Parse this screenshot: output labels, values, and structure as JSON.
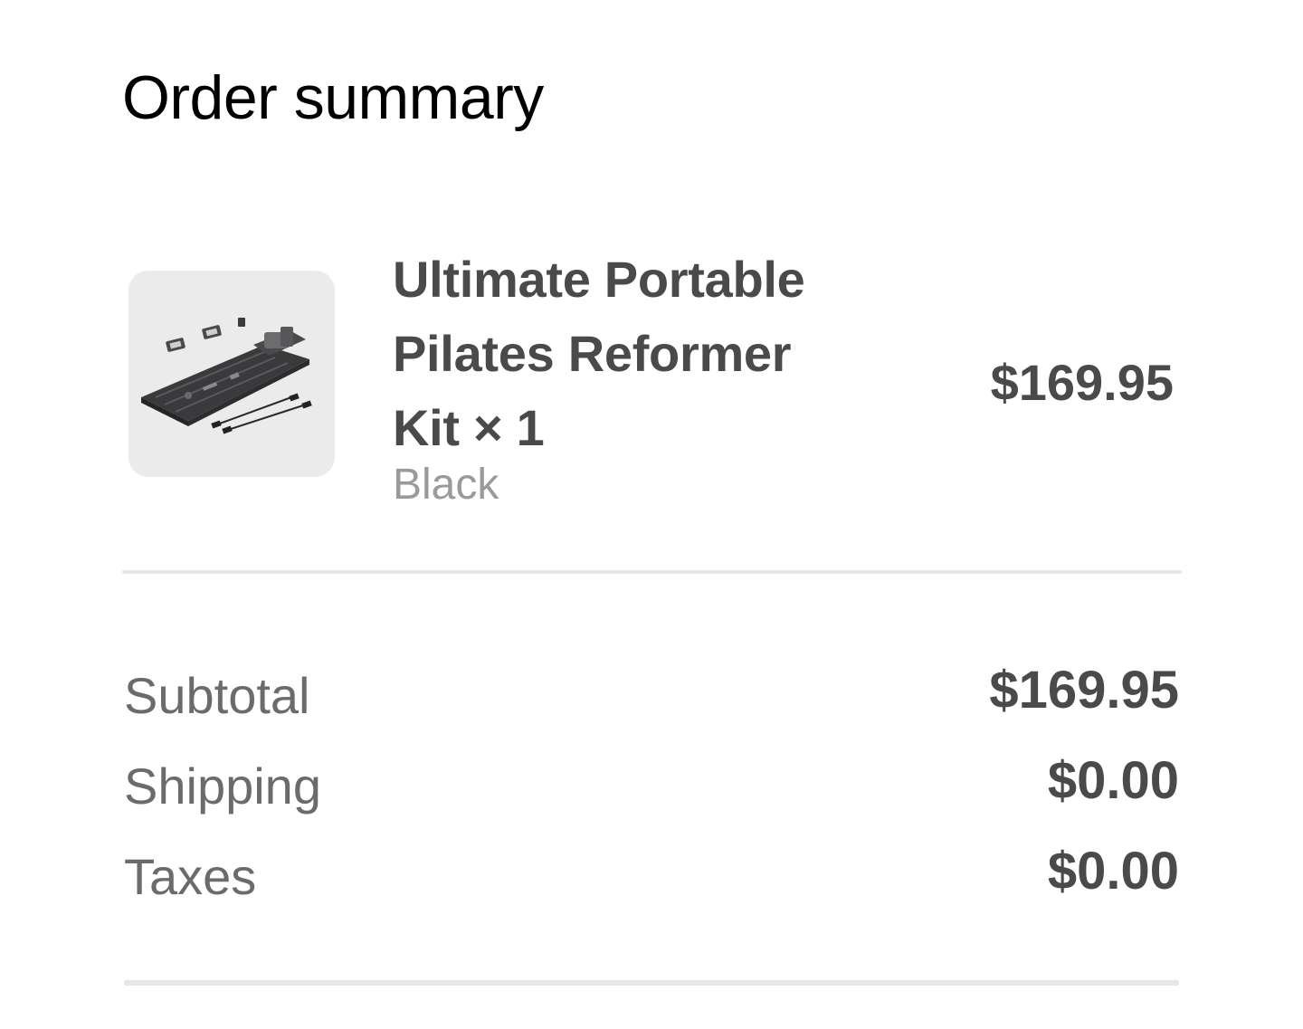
{
  "page": {
    "title": "Order summary"
  },
  "item": {
    "name": "Ultimate Portable Pilates Reformer Kit × 1",
    "variant": "Black",
    "price": "$169.95",
    "image_icon": "pilates-reformer-kit-image"
  },
  "totals": {
    "subtotal_label": "Subtotal",
    "subtotal_value": "$169.95",
    "shipping_label": "Shipping",
    "shipping_value": "$0.00",
    "taxes_label": "Taxes",
    "taxes_value": "$0.00"
  },
  "colors": {
    "heading": "#000000",
    "strong_text": "#4a4a4a",
    "muted_text": "#6b6b6b",
    "variant_text": "#9a9a9a",
    "divider": "#e6e6e6",
    "thumb_bg": "#ebebeb"
  }
}
